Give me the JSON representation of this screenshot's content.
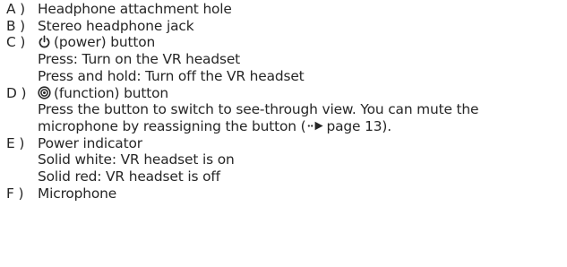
{
  "items": [
    {
      "letter": "A )",
      "title": "Headphone attachment hole"
    },
    {
      "letter": "B )",
      "title": "Stereo headphone jack"
    },
    {
      "letter": "C )",
      "icon": "power-icon",
      "title": "(power) button",
      "lines": [
        "Press: Turn on the VR headset",
        "Press and hold: Turn off the VR headset"
      ]
    },
    {
      "letter": "D )",
      "icon": "function-icon",
      "title": "(function) button",
      "para_line1": "Press the button to switch to see-through view. You can mute the",
      "para_line2_prefix": "microphone by reassigning the button (",
      "para_line2_ref_icon": "page-reference-arrow-icon",
      "para_line2_ref": "page 13",
      "para_line2_suffix": ")."
    },
    {
      "letter": "E )",
      "title": "Power indicator",
      "lines": [
        "Solid white: VR headset is on",
        "Solid red: VR headset is off"
      ]
    },
    {
      "letter": "F )",
      "title": "Microphone"
    }
  ]
}
